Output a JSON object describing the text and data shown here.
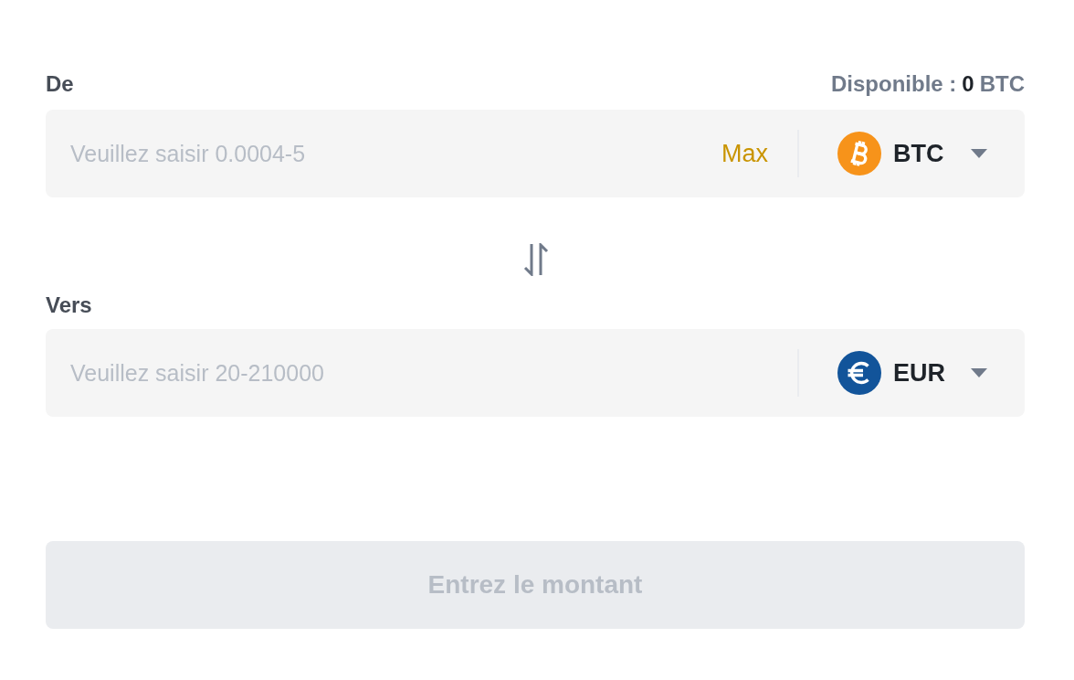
{
  "from": {
    "label": "De",
    "available": {
      "label": "Disponible :",
      "amount": "0",
      "unit": "BTC"
    },
    "placeholder": "Veuillez saisir 0.0004-5",
    "max_label": "Max",
    "currency": {
      "code": "BTC",
      "kind": "bitcoin"
    }
  },
  "to": {
    "label": "Vers",
    "placeholder": "Veuillez saisir 20-210000",
    "currency": {
      "code": "EUR",
      "kind": "euro"
    }
  },
  "submit": {
    "label": "Entrez le montant",
    "disabled": true
  }
}
